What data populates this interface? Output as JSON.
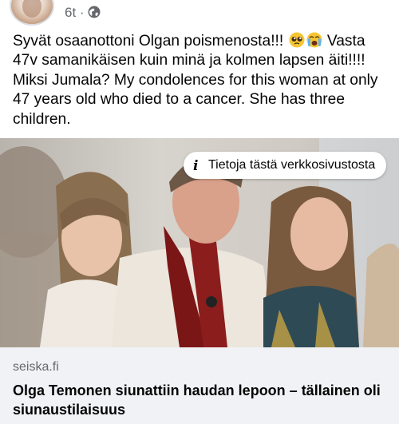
{
  "post": {
    "time_label": "6t ·",
    "privacy_icon": "globe-icon",
    "text_line1": "Syvät osaanottoni Olgan poismenosta!!! ",
    "text_line1b": " Vasta 47v samanikäisen kuin minä ja kolmen lapsen äiti!!!! Miksi Jumala? My condolences for this woman at only 47 years old who died to a cancer. She has three children.",
    "emojis": [
      "pleading-face-icon",
      "crying-face-icon"
    ]
  },
  "link_preview": {
    "info_icon": "info-icon",
    "info_label": "Tietoja tästä verkkosivustosta",
    "domain": "seiska.fi",
    "headline": "Olga Temonen siunattiin haudan lepoon – tällainen oli siunaustilaisuus"
  }
}
